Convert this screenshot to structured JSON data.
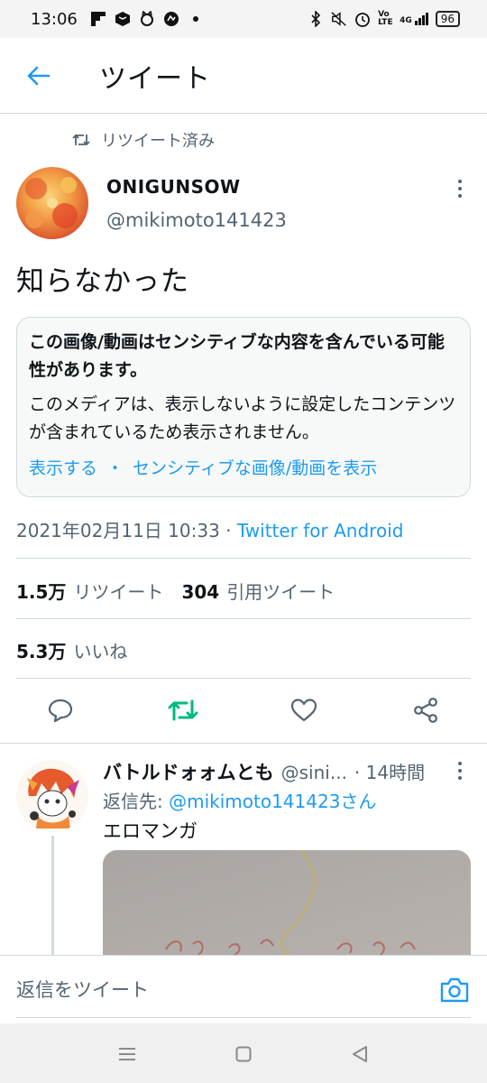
{
  "status_bar": {
    "time": "13:06",
    "battery": "96",
    "icons_left": [
      "flipboard-icon",
      "box-icon",
      "cat-icon",
      "circle-app-icon",
      "dot-icon"
    ],
    "icons_right": [
      "bluetooth-icon",
      "mute-icon",
      "alarm-icon",
      "volte-icon",
      "signal-4g-icon",
      "battery-icon"
    ],
    "volte_label": "Vo LTE",
    "net_label": "4G"
  },
  "header": {
    "title": "ツイート",
    "back_icon": "back-arrow-icon"
  },
  "retweet_indicator": {
    "label": "リツイート済み",
    "icon": "retweet-icon"
  },
  "tweet": {
    "author_name": "ONIGUNSOW",
    "author_handle": "@mikimoto141423",
    "text": "知らなかった",
    "sensitive": {
      "title": "この画像/動画はセンシティブな内容を含んでいる可能性があります。",
      "body": "このメディアは、表示しないように設定したコンテンツが含まれているため表示されません。",
      "link_show": "表示する",
      "separator": "・",
      "link_settings": "センシティブな画像/動画を表示"
    },
    "timestamp": "2021年02月11日 10:33",
    "meta_sep": " · ",
    "client": "Twitter for Android",
    "retweets_count": "1.5万",
    "retweets_label": "リツイート",
    "quotes_count": "304",
    "quotes_label": "引用ツイート",
    "likes_count": "5.3万",
    "likes_label": "いいね",
    "accent_color": "#1d9bf0",
    "retweet_active_color": "#00ba7c"
  },
  "actions": [
    "reply-icon",
    "retweet-icon",
    "like-icon",
    "share-icon"
  ],
  "reply": {
    "name": "バトルドォォムとも",
    "handle": "@sini...",
    "time": "· 14時間",
    "reply_to_prefix": "返信先: ",
    "reply_to_mention": "@mikimoto141423さん",
    "text": "エロマンガ"
  },
  "compose": {
    "placeholder": "返信をツイート",
    "camera_icon": "camera-icon"
  },
  "nav": [
    "menu-icon",
    "home-icon",
    "back-icon"
  ]
}
